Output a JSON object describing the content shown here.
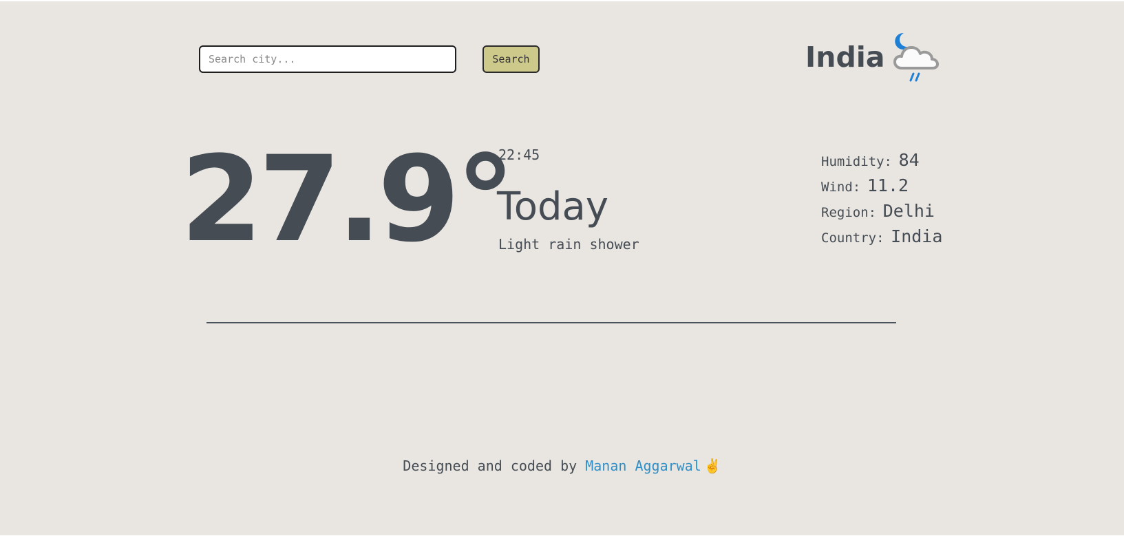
{
  "search": {
    "placeholder": "Search city...",
    "value": "",
    "button_label": "Search"
  },
  "header": {
    "location": "India",
    "weather_icon": "moon-cloud-rain-icon"
  },
  "current": {
    "temperature": "27.9°",
    "time": "22:45",
    "day": "Today",
    "condition": "Light rain shower"
  },
  "stats": {
    "humidity_label": "Humidity:",
    "humidity_value": "84",
    "wind_label": "Wind:",
    "wind_value": "11.2",
    "region_label": "Region:",
    "region_value": "Delhi",
    "country_label": "Country:",
    "country_value": "India"
  },
  "footer": {
    "prefix": "Designed and coded by",
    "author": "Manan Aggarwal",
    "emoji_icon": "victory-hand-icon"
  },
  "colors": {
    "background": "#e9e6e2",
    "text": "#454c53",
    "button": "#cdc98b",
    "link": "#2f8fc8",
    "moon": "#1e7fd6",
    "rain": "#1e7fd6",
    "cloud": "#9a9a9a"
  }
}
